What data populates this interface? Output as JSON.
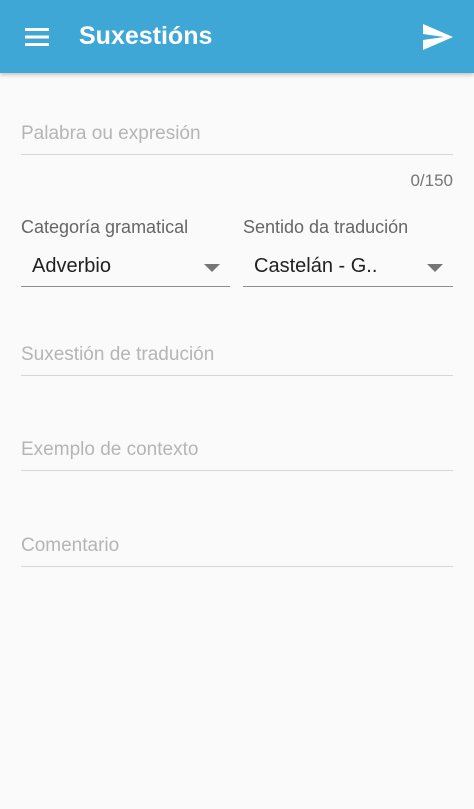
{
  "app_bar": {
    "title": "Suxestións",
    "menu_icon": "menu-icon",
    "send_icon": "send-icon",
    "color": "#3fa7d6"
  },
  "form": {
    "word": {
      "placeholder": "Palabra ou expresión",
      "value": "",
      "counter": "0/150"
    },
    "category": {
      "label": "Categoría gramatical",
      "selected": "Adverbio"
    },
    "direction": {
      "label": "Sentido da tradución",
      "selected": "Castelán - G.."
    },
    "suggestion": {
      "placeholder": "Suxestión de tradución",
      "value": ""
    },
    "context_example": {
      "placeholder": "Exemplo de contexto",
      "value": ""
    },
    "comment": {
      "placeholder": "Comentario",
      "value": ""
    }
  }
}
